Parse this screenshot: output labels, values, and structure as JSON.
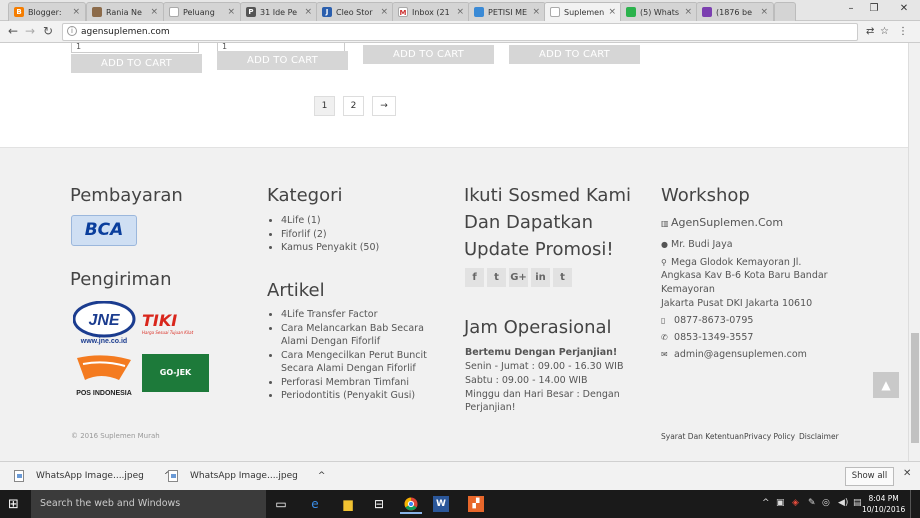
{
  "browser": {
    "tabs": [
      {
        "title": "Blogger:",
        "color": "#f57d00",
        "glyph": "B"
      },
      {
        "title": "Rania Ne",
        "color": "#8c6b4a",
        "glyph": ""
      },
      {
        "title": "Peluang",
        "color": "#ffffff",
        "glyph": ""
      },
      {
        "title": "31 Ide Pe",
        "color": "#555555",
        "glyph": "P"
      },
      {
        "title": "Cleo Stor",
        "color": "#2b5fae",
        "glyph": "J"
      },
      {
        "title": "Inbox (21",
        "color": "#ffffff",
        "glyph": "M"
      },
      {
        "title": "PETISI ME",
        "color": "#3a8ad6",
        "glyph": ""
      },
      {
        "title": "Suplemen",
        "color": "#ffffff",
        "glyph": ""
      },
      {
        "title": "(5) Whats",
        "color": "#2bb24c",
        "glyph": ""
      },
      {
        "title": "(1876 be",
        "color": "#7b3fb0",
        "glyph": ""
      }
    ],
    "url": "agensuplemen.com"
  },
  "products": {
    "qty_values": [
      "1",
      "1"
    ],
    "cart_label": "ADD TO CART"
  },
  "pagination": {
    "pages": [
      "1",
      "2"
    ],
    "next": "→"
  },
  "footer": {
    "pembayaran_title": "Pembayaran",
    "bca_label": "BCA",
    "pengiriman_title": "Pengiriman",
    "jne_label": "JNE",
    "jne_sub": "www.jne.co.id",
    "tiki_label": "TIKI",
    "tiki_tagline": "Harga Sesuai Tujuan Kilat",
    "pos_label": "POS INDONESIA",
    "gojek_label": "GO-JEK",
    "kategori_title": "Kategori",
    "kategori": [
      "4Life (1)",
      "Fiforlif (2)",
      "Kamus Penyakit (50)"
    ],
    "artikel_title": "Artikel",
    "artikel": [
      "4Life Transfer Factor",
      "Cara Melancarkan Bab Secara Alami Dengan Fiforlif",
      "Cara Mengecilkan Perut Buncit Secara Alami Dengan Fiforlif",
      "Perforasi Membran Timfani",
      "Periodontitis (Penyakit Gusi)"
    ],
    "sosmed_title_1": "Ikuti Sosmed Kami",
    "sosmed_title_2": "Dan Dapatkan",
    "sosmed_title_3": "Update Promosi!",
    "socials": [
      "f",
      "t",
      "G+",
      "in",
      "t"
    ],
    "jam_title": "Jam Operasional",
    "jam_bold": "Bertemu Dengan Perjanjian!",
    "jam_1": "Senin - Jumat : 09.00 - 16.30 WIB",
    "jam_2": "Sabtu : 09.00 - 14.00 WIB",
    "jam_3": "Minggu dan Hari Besar : Dengan",
    "jam_4": "Perjanjian!",
    "workshop_title": "Workshop",
    "workshop_name": "AgenSuplemen.Com",
    "contact_person": "Mr. Budi Jaya",
    "addr_1": "Mega Glodok Kemayoran Jl.",
    "addr_2": "Angkasa Kav B-6 Kota Baru Bandar",
    "addr_3": "Kemayoran",
    "addr_4": "Jakarta Pusat DKI Jakarta 10610",
    "phone_1": "0877-8673-0795",
    "phone_2": "0853-1349-3557",
    "email": "admin@agensuplemen.com",
    "copyright": "© 2016 Suplemen Murah",
    "links": [
      "Syarat Dan Ketentuan",
      "Privacy Policy",
      "Disclaimer"
    ]
  },
  "downloads": [
    {
      "name": "WhatsApp Image....jpeg"
    },
    {
      "name": "WhatsApp Image....jpeg"
    }
  ],
  "show_all": "Show all",
  "taskbar": {
    "search_placeholder": "Search the web and Windows",
    "time": "8:04 PM",
    "date": "10/10/2016"
  }
}
